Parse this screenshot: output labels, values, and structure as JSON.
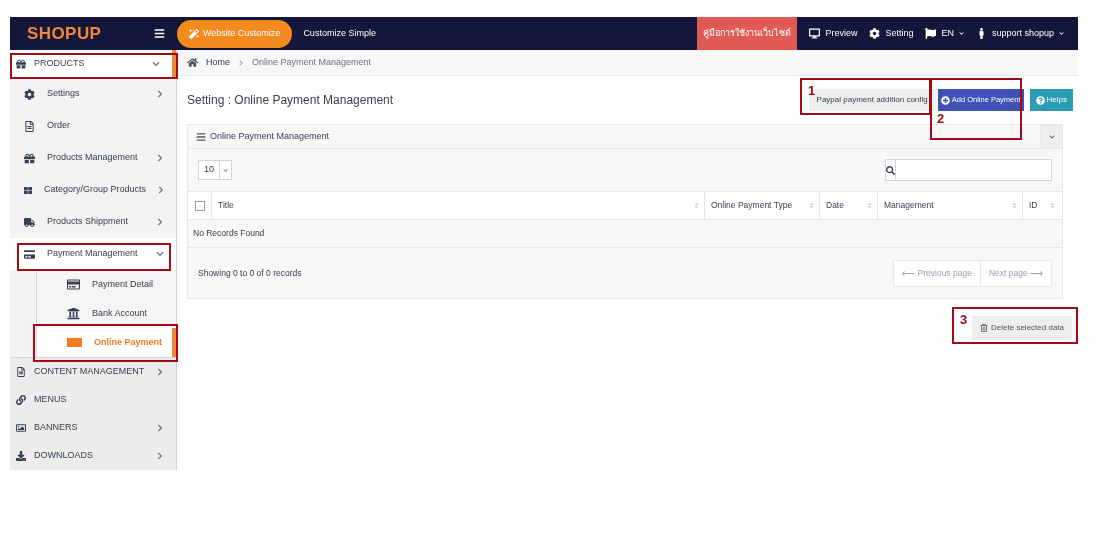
{
  "header": {
    "logo": "SHOPUP",
    "customize_button": "Website Customize",
    "customize_simple": "Customize Simple",
    "guide_button": "คู่มือการใช้งานเว็บไซต์",
    "nav": [
      "Preview",
      "Setting",
      "EN",
      "support shopup"
    ]
  },
  "sidebar": {
    "items": [
      {
        "label": "PRODUCTS",
        "kind": "menu",
        "expanded": true,
        "children": [
          {
            "label": "Settings",
            "kind": "menu",
            "expanded": false
          },
          {
            "label": "Order",
            "kind": "link"
          },
          {
            "label": "Products Management",
            "kind": "menu",
            "expanded": false
          },
          {
            "label": "Category/Group Products",
            "kind": "menu",
            "expanded": false
          },
          {
            "label": "Products Shippment",
            "kind": "menu",
            "expanded": false
          },
          {
            "label": "Payment Management",
            "kind": "menu",
            "expanded": true,
            "children": [
              {
                "label": "Payment Detail",
                "selected": false
              },
              {
                "label": "Bank Account",
                "selected": false
              },
              {
                "label": "Online Payment",
                "selected": true
              }
            ]
          }
        ]
      },
      {
        "label": "CONTENT MANAGEMENT",
        "kind": "menu",
        "expanded": false
      },
      {
        "label": "MENUS",
        "kind": "link"
      },
      {
        "label": "BANNERS",
        "kind": "menu",
        "expanded": false
      },
      {
        "label": "DOWNLOADS",
        "kind": "menu",
        "expanded": false
      }
    ]
  },
  "breadcrumb": [
    "Home",
    "Online Payment Management"
  ],
  "page_title": "Setting : Online Payment Management",
  "actions": [
    "Paypal payment addition config",
    "Add Online Payment",
    "Helps"
  ],
  "panel": {
    "title": "Online Payment Management",
    "page_size": "10",
    "table": {
      "select_all": {
        "checked": false
      },
      "columns": [
        "Title",
        "Online Payment Type",
        "Date",
        "Management",
        "ID"
      ],
      "empty_message": "No Records Found"
    },
    "summary": "Showing 0 to 0 of 0 records",
    "pagination": [
      "⟵ Previous page",
      "Next page ⟶"
    ]
  },
  "delete_button": "Delete selected data",
  "annotations": [
    "1",
    "2",
    "3"
  ]
}
